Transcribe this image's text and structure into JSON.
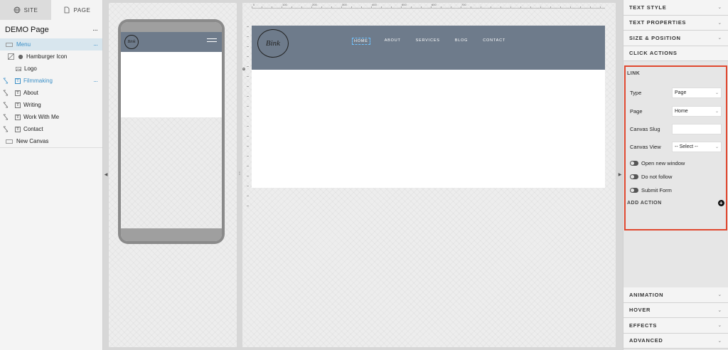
{
  "left_panel": {
    "tabs": [
      {
        "label": "SITE",
        "icon": "globe-icon",
        "active": false
      },
      {
        "label": "PAGE",
        "icon": "page-icon",
        "active": true
      }
    ],
    "page_title": "DEMO Page",
    "menu_dots": "···",
    "layers": [
      {
        "label": "Menu",
        "selected": true,
        "icon": "rectangle-icon"
      },
      {
        "label": "Hamburger Icon",
        "icon": "hamburger-layer-icon"
      },
      {
        "label": "Logo",
        "icon": "image-icon"
      },
      {
        "label": "Filmmaking",
        "icon": "text-icon",
        "highlighted": true
      },
      {
        "label": "About",
        "icon": "text-icon"
      },
      {
        "label": "Writing",
        "icon": "text-icon"
      },
      {
        "label": "Work With Me",
        "icon": "text-icon"
      },
      {
        "label": "Contact",
        "icon": "text-icon"
      },
      {
        "label": "New Canvas",
        "icon": "rectangle-icon"
      }
    ]
  },
  "phone_preview": {
    "logo_text": "Bink"
  },
  "canvas": {
    "ruler_labels": [
      "0",
      "100",
      "200",
      "300",
      "400",
      "500",
      "600",
      "700"
    ],
    "logo_text": "Bink",
    "nav_items": [
      "HOME",
      "ABOUT",
      "SERVICES",
      "BLOG",
      "CONTACT"
    ]
  },
  "right_panel": {
    "top_sections": [
      "TEXT STYLE",
      "TEXT PROPERTIES",
      "SIZE & POSITION"
    ],
    "click_actions_label": "CLICK ACTIONS",
    "link": {
      "title": "LINK",
      "type_label": "Type",
      "type_value": "Page",
      "page_label": "Page",
      "page_value": "Home",
      "canvas_slug_label": "Canvas Slug",
      "canvas_slug_value": "",
      "canvas_view_label": "Canvas View",
      "canvas_view_value": "-- Select --",
      "toggles": [
        "Open new window",
        "Do not follow",
        "Submit Form"
      ]
    },
    "add_action_label": "ADD ACTION",
    "bottom_sections": [
      "ANIMATION",
      "HOVER",
      "EFFECTS",
      "ADVANCED"
    ],
    "accent_color": "#e0482f"
  }
}
